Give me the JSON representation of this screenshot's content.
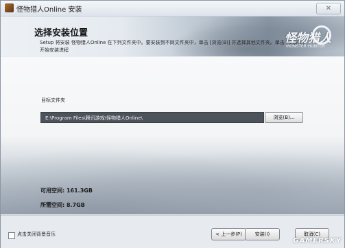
{
  "window": {
    "title": "怪物猎人Online 安装"
  },
  "header": {
    "title": "选择安装位置",
    "description": "Setup 将安装 怪物猎人Online 在下列文件夹中。要安装到不同文件夹中，单击 [浏览(B)] 并选择其他文件夹。单击 [安装(I)] 开始安装进程",
    "logo_text": "怪物猎人",
    "logo_sub": "MONSTER HUNTER"
  },
  "content": {
    "folder_label": "目标文件夹",
    "install_path": "E:\\Program Files\\腾讯游戏\\怪物猎人Online\\",
    "browse_label": "浏览(B)...",
    "space_free": "可用空间: 161.3GB",
    "space_required": "所需空间: 8.7GB"
  },
  "footer": {
    "checkbox_label": "点击关闭背景音乐",
    "back_label": "< 上一步(P)",
    "install_label": "安装(I)",
    "cancel_label": "取消(C)",
    "watermark": "GAMERSKY"
  }
}
